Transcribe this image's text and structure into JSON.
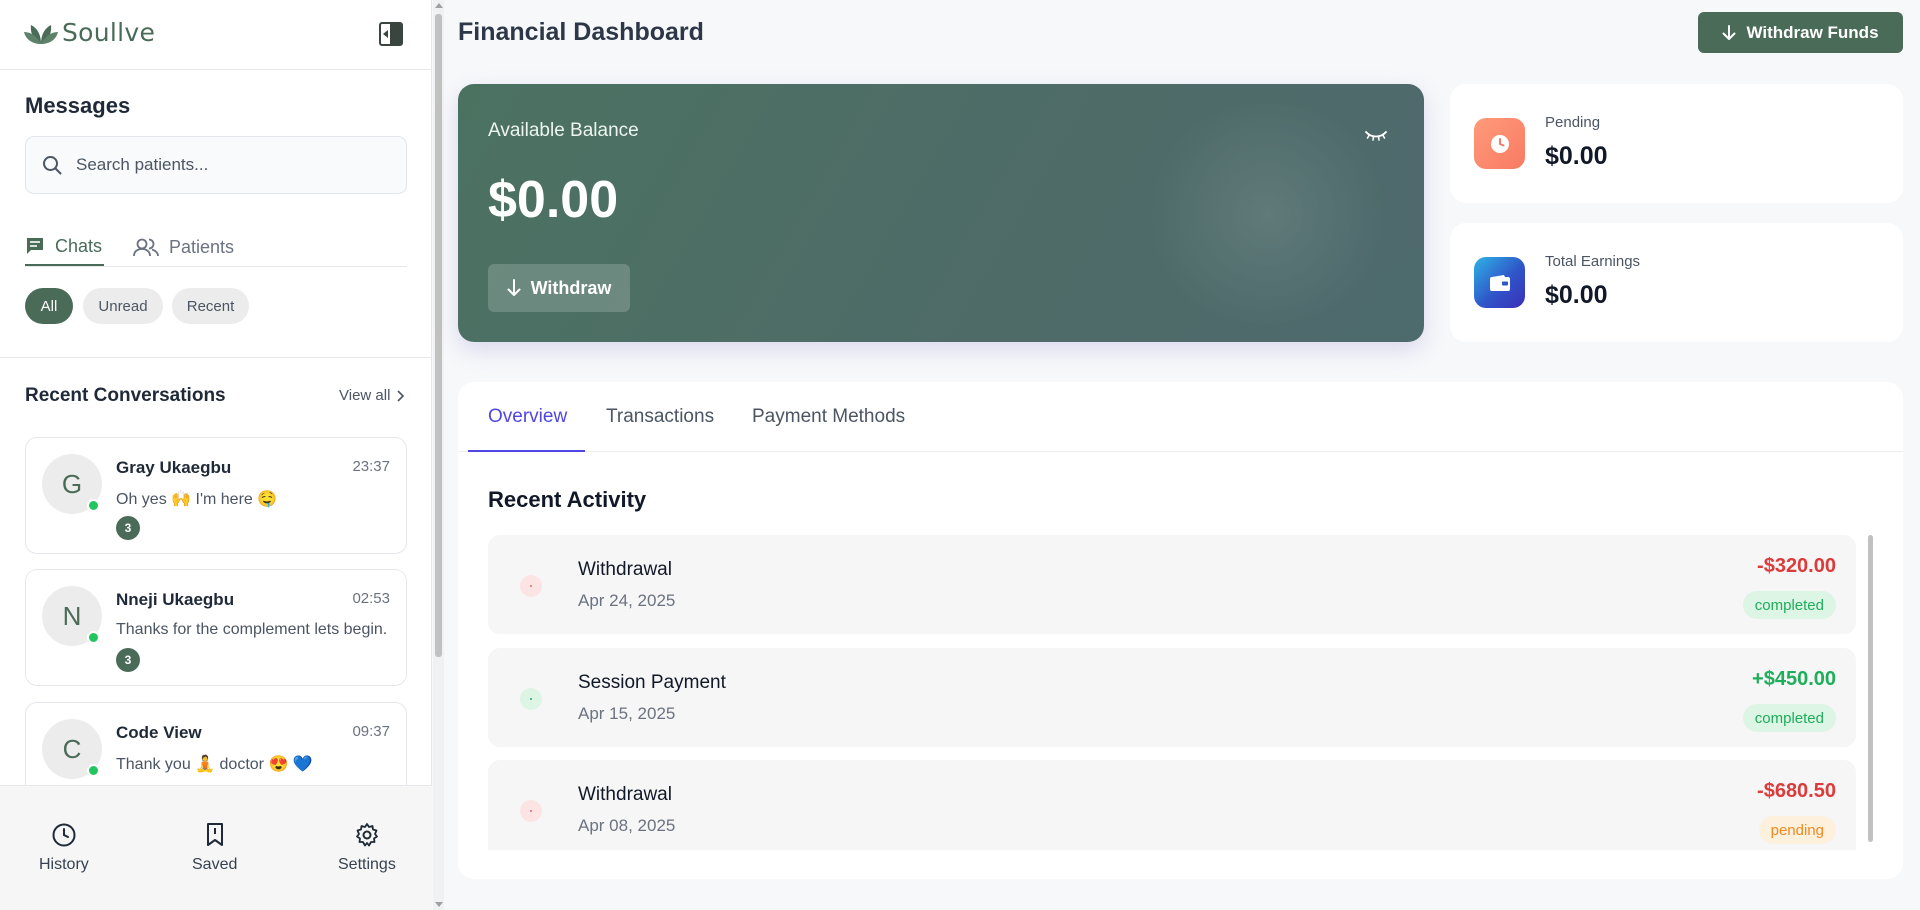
{
  "brand": {
    "name": "Soullve"
  },
  "sidebar": {
    "messages_title": "Messages",
    "search_placeholder": "Search patients...",
    "tabs": [
      {
        "label": "Chats",
        "icon": "chat-icon",
        "active": true
      },
      {
        "label": "Patients",
        "icon": "users-icon",
        "active": false
      }
    ],
    "filters": [
      {
        "label": "All",
        "active": true
      },
      {
        "label": "Unread",
        "active": false
      },
      {
        "label": "Recent",
        "active": false
      }
    ],
    "recent_title": "Recent Conversations",
    "view_all": "View all",
    "conversations": [
      {
        "initial": "G",
        "name": "Gray Ukaegbu",
        "time": "23:37",
        "preview": "Oh yes 🙌 I'm here 🤤",
        "unread": "3",
        "online": true
      },
      {
        "initial": "N",
        "name": "Nneji Ukaegbu",
        "time": "02:53",
        "preview": "Thanks for the complement lets begin.",
        "unread": "3",
        "online": true
      },
      {
        "initial": "C",
        "name": "Code View",
        "time": "09:37",
        "preview": "Thank you 🧘 doctor 😍 💙",
        "unread": "",
        "online": true
      }
    ],
    "bottom_nav": [
      {
        "label": "History",
        "icon": "clock-icon"
      },
      {
        "label": "Saved",
        "icon": "bookmark-icon"
      },
      {
        "label": "Settings",
        "icon": "gear-icon"
      }
    ]
  },
  "main": {
    "title": "Financial Dashboard",
    "withdraw_funds_label": "Withdraw Funds",
    "balance": {
      "label": "Available Balance",
      "amount": "$0.00",
      "withdraw_label": "Withdraw"
    },
    "stats": [
      {
        "label": "Pending",
        "value": "$0.00",
        "icon": "clock-icon",
        "color": "#fb8c6e"
      },
      {
        "label": "Total Earnings",
        "value": "$0.00",
        "icon": "wallet-icon",
        "color": "#2f56c9"
      }
    ],
    "tabs": [
      {
        "label": "Overview",
        "active": true
      },
      {
        "label": "Transactions",
        "active": false
      },
      {
        "label": "Payment Methods",
        "active": false
      }
    ],
    "recent_activity_title": "Recent Activity",
    "activities": [
      {
        "title": "Withdrawal",
        "date": "Apr 24, 2025",
        "amount": "-$320.00",
        "status": "completed",
        "kind": "debit"
      },
      {
        "title": "Session Payment",
        "date": "Apr 15, 2025",
        "amount": "+$450.00",
        "status": "completed",
        "kind": "credit"
      },
      {
        "title": "Withdrawal",
        "date": "Apr 08, 2025",
        "amount": "-$680.50",
        "status": "pending",
        "kind": "debit"
      }
    ]
  },
  "colors": {
    "brand_green": "#4a6b58",
    "accent_indigo": "#4f46e5",
    "debit_red": "#dc3b3b",
    "credit_green": "#1fae5b",
    "pending_orange": "#ef8a1f"
  }
}
